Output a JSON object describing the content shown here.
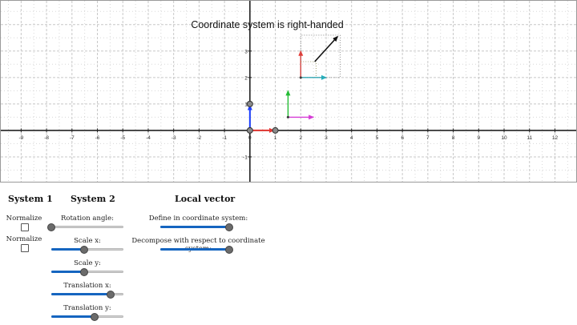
{
  "plot": {
    "title": "Coordinate system is right-handed",
    "x_ticks": [
      "-9",
      "-8",
      "-7",
      "-6",
      "-5",
      "-4",
      "-3",
      "-2",
      "-1",
      "0",
      "1",
      "2",
      "3",
      "4",
      "5",
      "6",
      "7",
      "8",
      "9",
      "10",
      "11",
      "12"
    ],
    "y_ticks": [
      "3",
      "2",
      "1",
      "-1"
    ],
    "xlim": [
      -9.8,
      12.9
    ],
    "ylim": [
      -2.0,
      4.9
    ],
    "colors": {
      "axis_x_red": "#e53935",
      "axis_y_blue": "#1e40ff",
      "local_x_magenta": "#d63cd6",
      "local_y_green": "#22bb33",
      "sys2_x_teal": "#20b2c0",
      "sys2_y_red": "#e53935",
      "vector": "#111111",
      "grid": "#c8c8c8",
      "handle": "#8a8a8a"
    }
  },
  "panel": {
    "system1": {
      "heading": "System 1",
      "normalize_u": "Normalize u:",
      "normalize_v": "Normalize v:",
      "normalize_u_checked": false,
      "normalize_v_checked": false
    },
    "system2": {
      "heading": "System 2",
      "rotation_label": "Rotation angle:",
      "rotation_value": 0.0,
      "scale_x_label": "Scale x:",
      "scale_x_value": 0.45,
      "scale_y_label": "Scale y:",
      "scale_y_value": 0.45,
      "translation_x_label": "Translation x:",
      "translation_x_value": 0.82,
      "translation_y_label": "Translation y:",
      "translation_y_value": 0.6
    },
    "local_vector": {
      "heading": "Local vector",
      "define_label": "Define in coordinate system:",
      "define_value": 0.95,
      "decompose_label": "Decompose with respect to coordinate system:",
      "decompose_value": 0.95
    }
  }
}
